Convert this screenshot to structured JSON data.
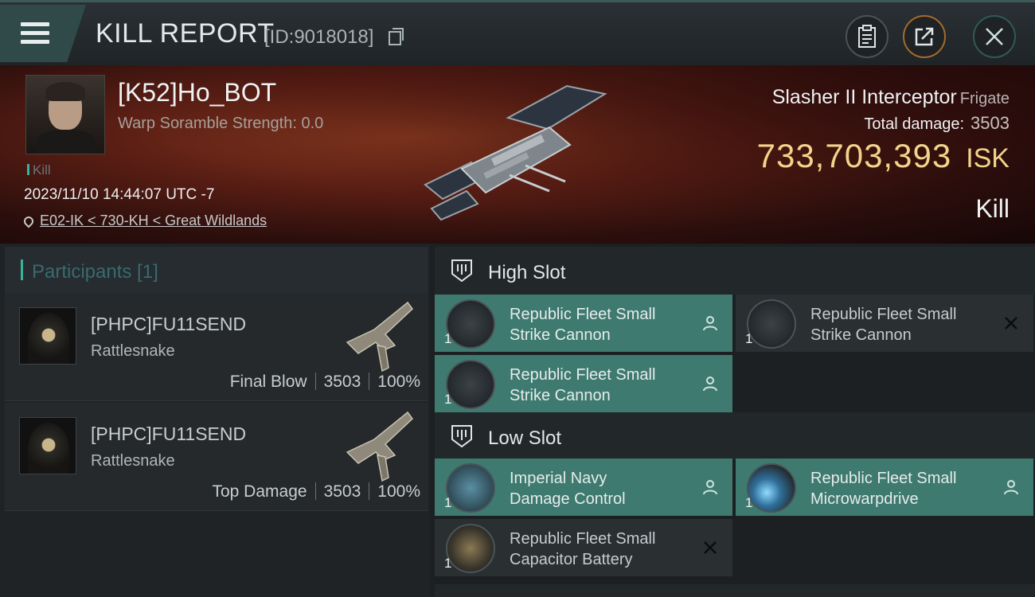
{
  "topbar": {
    "title": "KILL REPORT",
    "report_id": "[ID:9018018]",
    "icons": [
      "menu-icon",
      "copy-icon",
      "clipboard-icon",
      "share-icon",
      "close-icon"
    ]
  },
  "victim": {
    "name": "[K52]Ho_BOT",
    "scramble": "Warp Soramble Strength: 0.0",
    "kill_tag": "Kill",
    "datetime": "2023/11/10 14:44:07 UTC -7",
    "location": "E02-IK < 730-KH < Great Wildlands",
    "ship": "Slasher II Interceptor",
    "ship_class": "Frigate",
    "total_damage_label": "Total damage:",
    "total_damage": "3503",
    "isk_amount": "733,703,393",
    "isk_unit": "ISK",
    "result": "Kill"
  },
  "participants": {
    "header": "Participants [1]",
    "items": [
      {
        "name": "[PHPC]FU11SEND",
        "ship": "Rattlesnake",
        "role": "Final Blow",
        "damage": "3503",
        "percent": "100%"
      },
      {
        "name": "[PHPC]FU11SEND",
        "ship": "Rattlesnake",
        "role": "Top Damage",
        "damage": "3503",
        "percent": "100%"
      }
    ]
  },
  "fitting": {
    "high_slot_label": "High Slot",
    "low_slot_label": "Low Slot",
    "high_modules": [
      {
        "name_line1": "Republic Fleet Small",
        "name_line2": "Strike Cannon",
        "qty": "1",
        "state": "fitted"
      },
      {
        "name_line1": "Republic Fleet Small",
        "name_line2": "Strike Cannon",
        "qty": "1",
        "state": "destroyed"
      },
      {
        "name_line1": "Republic Fleet Small",
        "name_line2": "Strike Cannon",
        "qty": "1",
        "state": "fitted"
      }
    ],
    "low_modules": [
      {
        "name_line1": "Imperial Navy",
        "name_line2": "Damage Control",
        "qty": "1",
        "state": "fitted"
      },
      {
        "name_line1": "Republic Fleet Small",
        "name_line2": "Microwarpdrive",
        "qty": "1",
        "state": "fitted"
      },
      {
        "name_line1": "Republic Fleet Small",
        "name_line2": "Capacitor Battery",
        "qty": "1",
        "state": "destroyed"
      }
    ]
  },
  "colors": {
    "accent_teal": "#3bb29d",
    "fitted_bg": "#3e7a70",
    "isk_gold": "#f3d48a"
  }
}
